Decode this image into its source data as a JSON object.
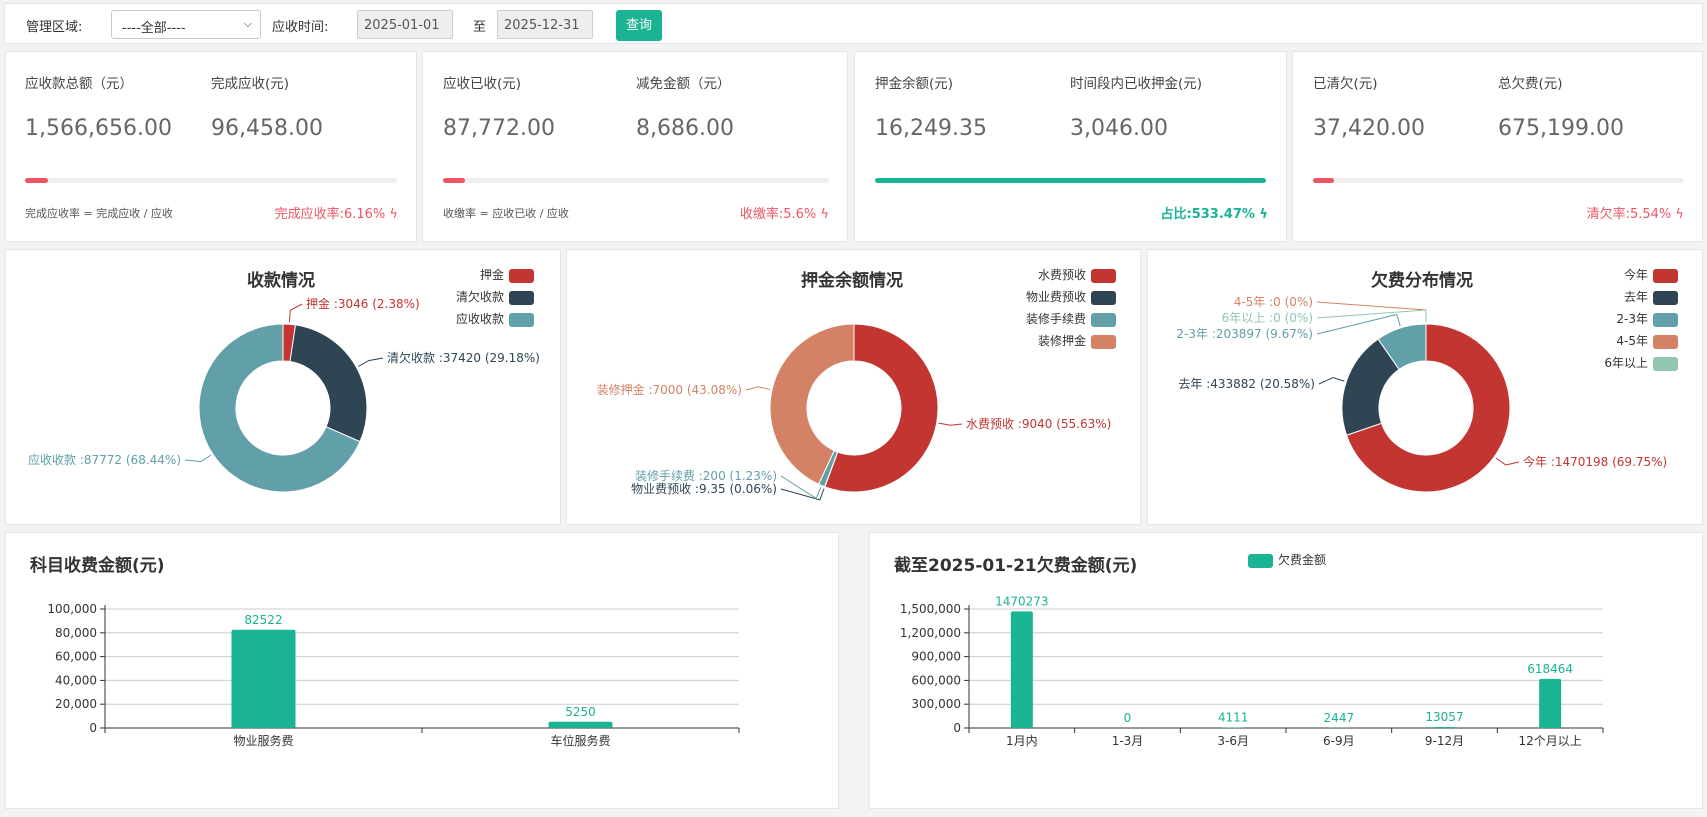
{
  "filter": {
    "area_label": "管理区域:",
    "area_value": "----全部----",
    "time_label": "应收时间:",
    "date_from": "2025-01-01",
    "to_label": "至",
    "date_to": "2025-12-31",
    "query_button": "查询"
  },
  "stats": [
    {
      "label1": "应收款总额（元）",
      "value1": "1,566,656.00",
      "label2": "完成应收(元)",
      "value2": "96,458.00",
      "progress": 0.0616,
      "bar_color": "#ed5565",
      "formula": "完成应收率 = 完成应收 / 应收",
      "rate": "完成应收率:6.16%",
      "rate_style": "red"
    },
    {
      "label1": "应收已收(元)",
      "value1": "87,772.00",
      "label2": "减免金额（元）",
      "value2": "8,686.00",
      "progress": 0.056,
      "bar_color": "#ed5565",
      "formula": "收缴率 = 应收已收 / 应收",
      "rate": "收缴率:5.6%",
      "rate_style": "red"
    },
    {
      "label1": "押金余额(元)",
      "value1": "16,249.35",
      "label2": "时间段内已收押金(元)",
      "value2": "3,046.00",
      "progress": 1.0,
      "bar_color": "#1ab394",
      "formula": "",
      "rate": "占比:533.47%",
      "rate_style": "green"
    },
    {
      "label1": "已清欠(元)",
      "value1": "37,420.00",
      "label2": "总欠费(元)",
      "value2": "675,199.00",
      "progress": 0.0554,
      "bar_color": "#ed5565",
      "formula": "",
      "rate": "清欠率:5.54%",
      "rate_style": "red"
    }
  ],
  "chart_data": [
    {
      "type": "pie",
      "title": "收款情况",
      "legend_position": "top-right",
      "slices": [
        {
          "name": "押金",
          "value": 3046,
          "label": "押金 :3046 (2.38%)",
          "color": "#c23531"
        },
        {
          "name": "清欠收款",
          "value": 37420,
          "label": "清欠收款 :37420 (29.18%)",
          "color": "#2f4554"
        },
        {
          "name": "应收收款",
          "value": 87772,
          "label": "应收收款 :87772 (68.44%)",
          "color": "#61a0a8"
        }
      ]
    },
    {
      "type": "pie",
      "title": "押金余额情况",
      "legend_position": "top-right",
      "slices": [
        {
          "name": "水费预收",
          "value": 9040,
          "label": "水费预收 :9040 (55.63%)",
          "color": "#c23531"
        },
        {
          "name": "物业费预收",
          "value": 9.35,
          "label": "物业费预收 :9.35 (0.06%)",
          "color": "#2f4554"
        },
        {
          "name": "装修手续费",
          "value": 200,
          "label": "装修手续费 :200 (1.23%)",
          "color": "#61a0a8"
        },
        {
          "name": "装修押金",
          "value": 7000,
          "label": "装修押金 :7000 (43.08%)",
          "color": "#d48265"
        }
      ]
    },
    {
      "type": "pie",
      "title": "欠费分布情况",
      "legend_position": "top-right",
      "slices": [
        {
          "name": "今年",
          "value": 1470198,
          "label": "今年 :1470198 (69.75%)",
          "color": "#c23531"
        },
        {
          "name": "去年",
          "value": 433882,
          "label": "去年 :433882 (20.58%)",
          "color": "#2f4554"
        },
        {
          "name": "2-3年",
          "value": 203897,
          "label": "2-3年 :203897 (9.67%)",
          "color": "#61a0a8"
        },
        {
          "name": "4-5年",
          "value": 0,
          "label": "4-5年 :0 (0%)",
          "color": "#d48265"
        },
        {
          "name": "6年以上",
          "value": 0,
          "label": "6年以上 :0 (0%)",
          "color": "#91c7ae"
        }
      ]
    },
    {
      "type": "bar",
      "title": "科目收费金额(元)",
      "categories": [
        "物业服务费",
        "车位服务费"
      ],
      "values": [
        82522,
        5250
      ],
      "ylim": [
        0,
        100000
      ],
      "yticks": [
        "0",
        "20,000",
        "40,000",
        "60,000",
        "80,000",
        "100,000"
      ],
      "color": "#1ab394",
      "grid": true
    },
    {
      "type": "bar",
      "title": "截至2025-01-21欠费金额(元)",
      "legend": "欠费金额",
      "legend_position": "top-center",
      "categories": [
        "1月内",
        "1-3月",
        "3-6月",
        "6-9月",
        "9-12月",
        "12个月以上"
      ],
      "values": [
        1470273,
        0,
        4111,
        2447,
        13057,
        618464
      ],
      "ylim": [
        0,
        1500000
      ],
      "yticks": [
        "0",
        "300,000",
        "600,000",
        "900,000",
        "1,200,000",
        "1,500,000"
      ],
      "color": "#1ab394",
      "grid": true
    }
  ]
}
